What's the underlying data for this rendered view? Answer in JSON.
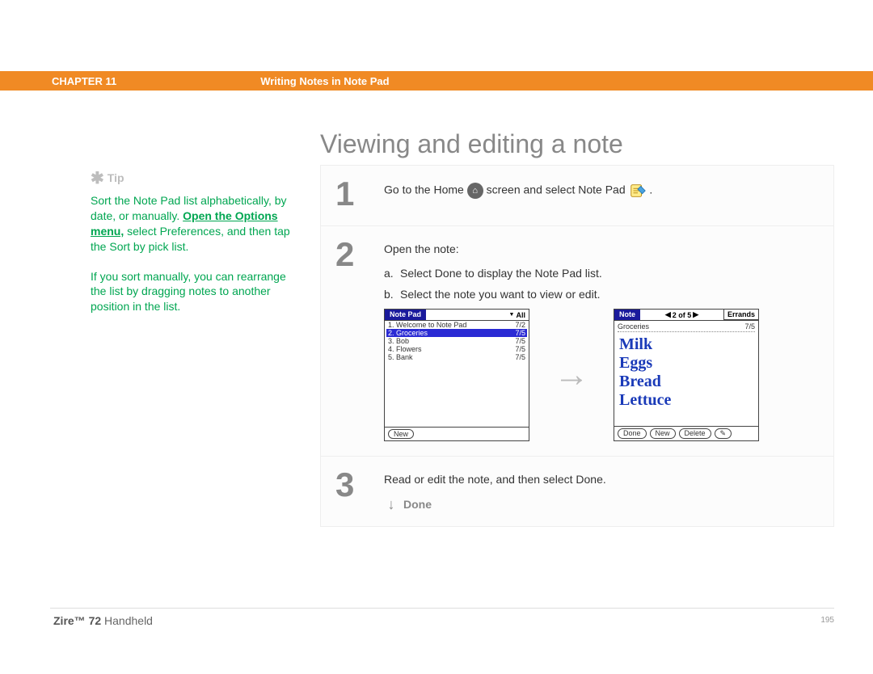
{
  "header": {
    "chapter": "CHAPTER 11",
    "section_title": "Writing Notes in Note Pad"
  },
  "page_title": "Viewing and editing a note",
  "tip": {
    "label": "Tip",
    "para1_pre": "Sort the Note Pad list alphabetically, by date, or manually. ",
    "para1_link": "Open the Options menu,",
    "para1_post": " select Preferences, and then tap the Sort by pick list.",
    "para2": "If you sort manually, you can rearrange the list by dragging notes to another position in the list."
  },
  "steps": {
    "s1": {
      "num": "1",
      "text_pre": "Go to the Home ",
      "text_mid": " screen and select Note Pad ",
      "text_post": " ."
    },
    "s2": {
      "num": "2",
      "lead": "Open the note:",
      "a": "Select Done to display the Note Pad list.",
      "b": "Select the note you want to view or edit."
    },
    "s3": {
      "num": "3",
      "text": "Read or edit the note, and then select Done.",
      "done": "Done"
    }
  },
  "palm_list": {
    "title": "Note Pad",
    "filter": "All",
    "items": [
      {
        "name": "1.  Welcome to Note Pad",
        "date": "7/2"
      },
      {
        "name": "2.  Groceries",
        "date": "7/5"
      },
      {
        "name": "3.  Bob",
        "date": "7/5"
      },
      {
        "name": "4.  Flowers",
        "date": "7/5"
      },
      {
        "name": "5.  Bank",
        "date": "7/5"
      }
    ],
    "new_btn": "New"
  },
  "palm_note": {
    "title": "Note",
    "counter": "2 of 5",
    "category": "Errands",
    "subject": "Groceries",
    "subject_date": "7/5",
    "lines": [
      "Milk",
      "Eggs",
      "Bread",
      "Lettuce"
    ],
    "done_btn": "Done",
    "new_btn": "New",
    "delete_btn": "Delete"
  },
  "footer": {
    "product_bold": "Zire™ 72",
    "product_rest": " Handheld",
    "pagenum": "195"
  }
}
